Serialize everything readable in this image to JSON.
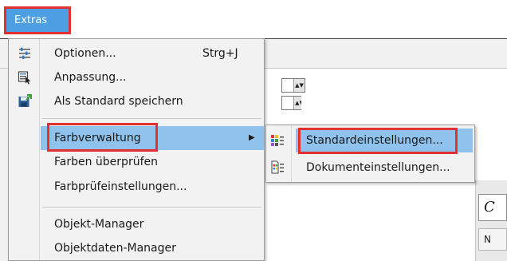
{
  "menubar": {
    "extras_label": "Extras"
  },
  "background": {
    "input_text": "C",
    "button_text": "N"
  },
  "menu": {
    "items": [
      {
        "label": "Optionen...",
        "shortcut": "Strg+J",
        "icon": "options-icon"
      },
      {
        "label": "Anpassung...",
        "icon": "customize-icon"
      },
      {
        "label": "Als Standard speichern",
        "icon": "save-default-icon"
      },
      {
        "label": "Farbverwaltung",
        "icon": "",
        "has_submenu": true
      },
      {
        "label": "Farben überprüfen",
        "icon": ""
      },
      {
        "label": "Farbprüfeinstellungen...",
        "icon": ""
      },
      {
        "label": "Objekt-Manager",
        "icon": ""
      },
      {
        "label": "Objektdaten-Manager",
        "icon": ""
      }
    ],
    "submenu_arrow": "▶"
  },
  "submenu": {
    "items": [
      {
        "label": "Standardeinstellungen...",
        "icon": "color-default-settings-icon"
      },
      {
        "label": "Dokumenteinstellungen...",
        "icon": "color-document-settings-icon"
      }
    ]
  },
  "colors": {
    "menu_highlight": "#8fc3ee",
    "annotation_red": "#e03030",
    "menubar_active": "#4c9fe2"
  }
}
